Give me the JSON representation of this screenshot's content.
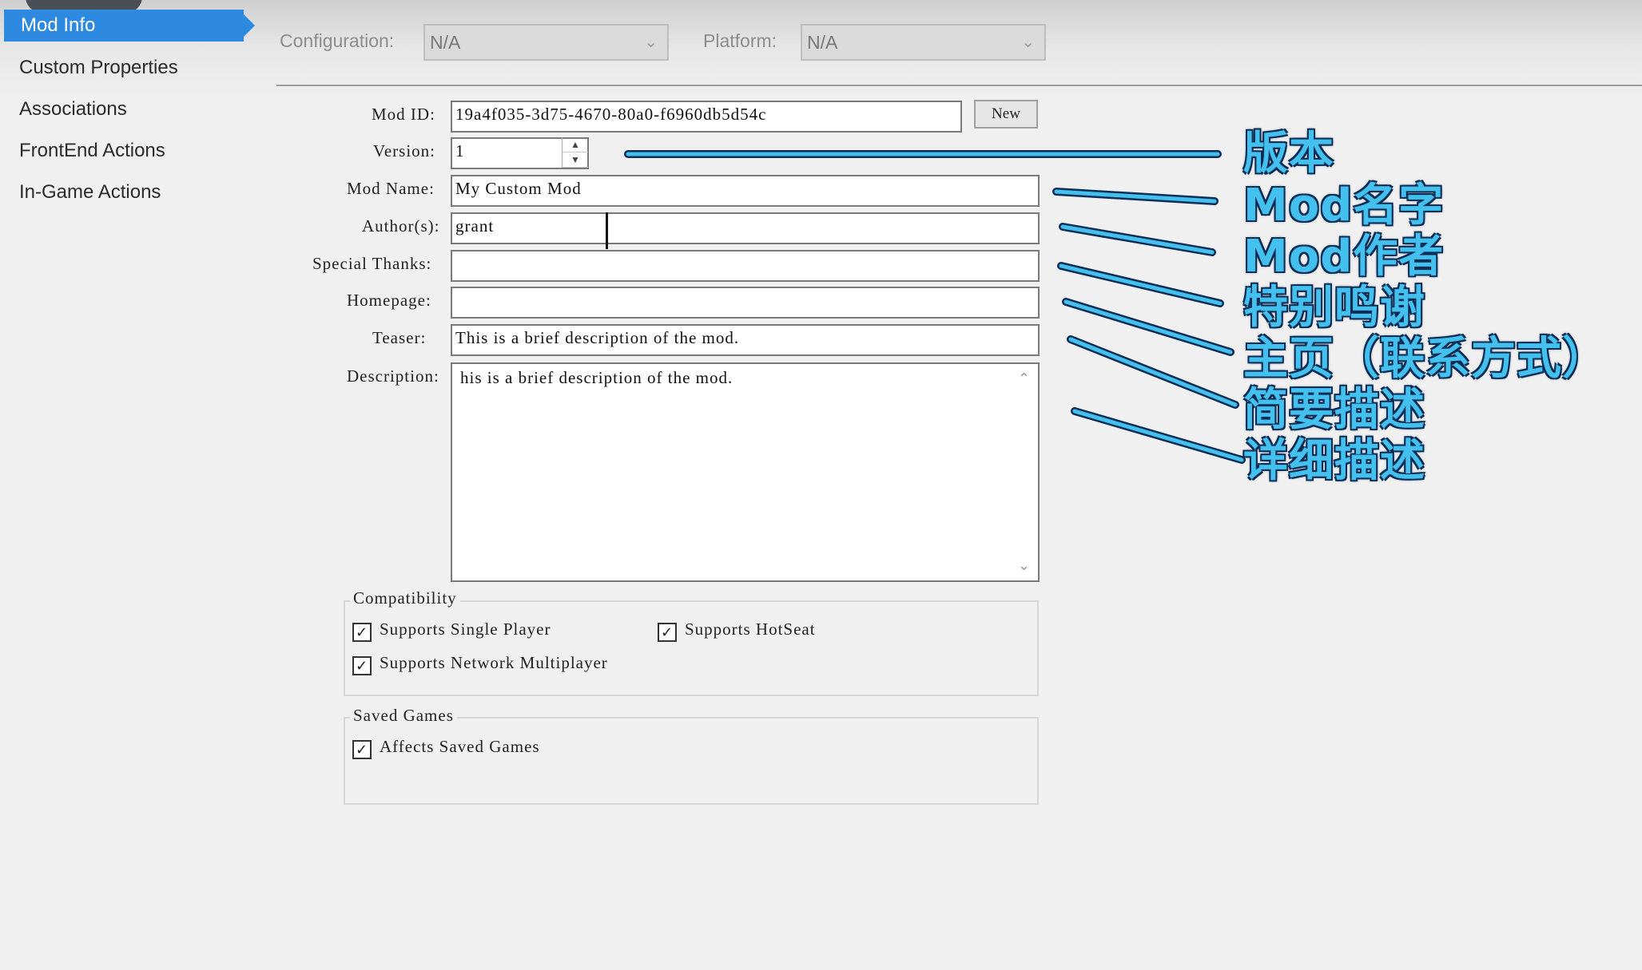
{
  "sidebar": {
    "items": [
      {
        "label": "Mod Info",
        "active": true
      },
      {
        "label": "Custom Properties"
      },
      {
        "label": "Associations"
      },
      {
        "label": "FrontEnd Actions"
      },
      {
        "label": "In-Game Actions"
      }
    ]
  },
  "toolbar": {
    "configuration_label": "Configuration:",
    "configuration_value": "N/A",
    "platform_label": "Platform:",
    "platform_value": "N/A"
  },
  "form": {
    "mod_id_label": "Mod ID:",
    "mod_id_value": "19a4f035-3d75-4670-80a0-f6960db5d54c",
    "new_button": "New",
    "version_label": "Version:",
    "version_value": "1",
    "mod_name_label": "Mod Name:",
    "mod_name_value": "My Custom Mod",
    "authors_label": "Author(s):",
    "authors_value": "grant",
    "special_thanks_label": "Special Thanks:",
    "special_thanks_value": "",
    "homepage_label": "Homepage:",
    "homepage_value": "",
    "teaser_label": "Teaser:",
    "teaser_value": "This is a brief description of the mod.",
    "description_label": "Description:",
    "description_value": "his is a brief description of the mod."
  },
  "compatibility": {
    "title": "Compatibility",
    "single_player": {
      "label": "Supports Single Player",
      "checked": true
    },
    "hotseat": {
      "label": "Supports HotSeat",
      "checked": true
    },
    "network": {
      "label": "Supports Network Multiplayer",
      "checked": true
    }
  },
  "saved_games": {
    "title": "Saved Games",
    "affects": {
      "label": "Affects Saved Games",
      "checked": true
    }
  },
  "annotations": {
    "version": "版本",
    "mod_name": "Mod名字",
    "author": "Mod作者",
    "special_thanks": "特别鸣谢",
    "homepage": "主页（联系方式）",
    "teaser": "简要描述",
    "description": "详细描述",
    "color": "#44c0ee"
  },
  "icons": {
    "dropdown": "chevron-down-icon",
    "spinner": "spinner-arrows-icon",
    "checkbox": "check-icon",
    "scroll_up": "chevron-up-icon",
    "scroll_down": "chevron-down-icon"
  }
}
